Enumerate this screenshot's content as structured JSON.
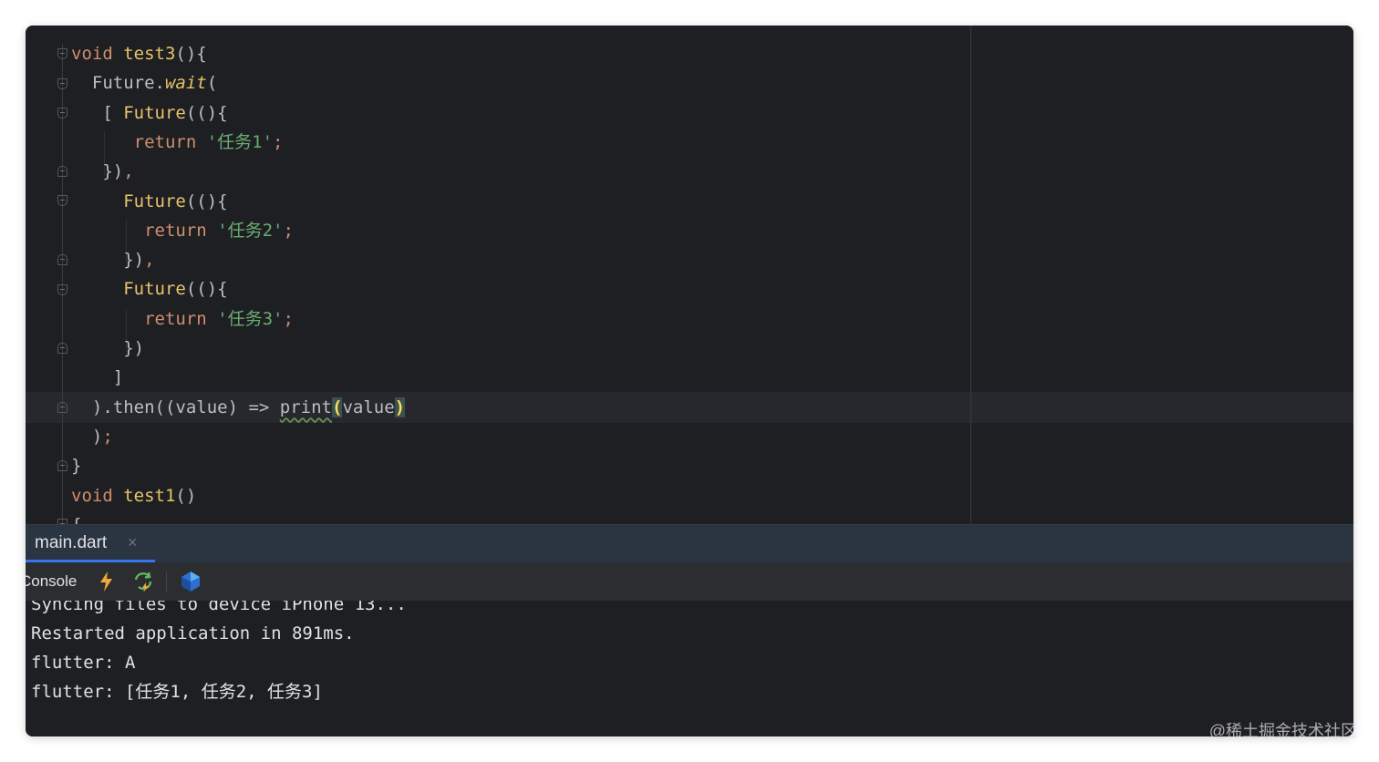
{
  "editor": {
    "lines": [
      [
        [
          "kw",
          "void "
        ],
        [
          "fn",
          "test3"
        ],
        [
          "plain",
          "(){"
        ]
      ],
      [
        [
          "plain",
          "  Future."
        ],
        [
          "it",
          "wait"
        ],
        [
          "plain",
          "("
        ]
      ],
      [
        [
          "plain",
          "   [ "
        ],
        [
          "fn",
          "Future"
        ],
        [
          "plain",
          "((){"
        ]
      ],
      [
        [
          "kw",
          "      return "
        ],
        [
          "str",
          "'任务1'"
        ],
        [
          "punc-o",
          ";"
        ]
      ],
      [
        [
          "plain",
          "   })"
        ],
        [
          "punc-o",
          ","
        ]
      ],
      [
        [
          "fn",
          "     Future"
        ],
        [
          "plain",
          "((){"
        ]
      ],
      [
        [
          "kw",
          "       return "
        ],
        [
          "str",
          "'任务2'"
        ],
        [
          "punc-o",
          ";"
        ]
      ],
      [
        [
          "plain",
          "     })"
        ],
        [
          "punc-o",
          ","
        ]
      ],
      [
        [
          "fn",
          "     Future"
        ],
        [
          "plain",
          "((){"
        ]
      ],
      [
        [
          "kw",
          "       return "
        ],
        [
          "str",
          "'任务3'"
        ],
        [
          "punc-o",
          ";"
        ]
      ],
      [
        [
          "plain",
          "     })"
        ]
      ],
      [
        [
          "plain",
          "    ]"
        ]
      ],
      [
        [
          "plain",
          "  ).then((value) => "
        ],
        [
          "squig",
          "print"
        ],
        [
          "hl-paren",
          "("
        ],
        [
          "plain",
          "value"
        ],
        [
          "hl-paren",
          ")"
        ]
      ],
      [
        [
          "plain",
          "  )"
        ],
        [
          "punc-o",
          ";"
        ]
      ],
      [
        [
          "plain",
          "}"
        ]
      ],
      [
        [
          "kw",
          "void "
        ],
        [
          "fn",
          "test1"
        ],
        [
          "plain",
          "()"
        ]
      ],
      [
        [
          "plain",
          "{"
        ]
      ]
    ]
  },
  "tabs": [
    {
      "label": "main.dart",
      "close": "×",
      "active": true
    }
  ],
  "toolbar": {
    "console_label": "Console",
    "icons": [
      "hot-reload-icon",
      "hot-restart-icon",
      "dart-devtools-icon"
    ]
  },
  "console": {
    "lines": [
      "Syncing files to device iPhone 13...",
      "Restarted application in 891ms.",
      "flutter: A",
      "flutter: [任务1, 任务2, 任务3]"
    ]
  },
  "watermark": "@稀土掘金技术社区",
  "colors": {
    "background": "#1e1f22",
    "keyword": "#cf8e6d",
    "function": "#e8c46a",
    "string": "#6aab73",
    "tab_accent": "#3574f0"
  }
}
